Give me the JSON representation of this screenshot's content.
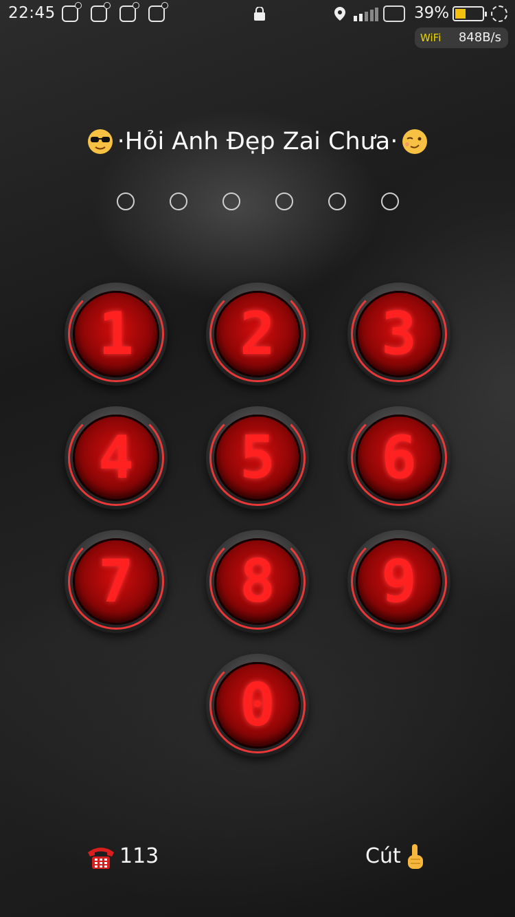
{
  "status_bar": {
    "time": "22:45",
    "notification_icons": [
      "mail-icon",
      "messenger-icon",
      "zalo-icon",
      "chat-icon"
    ],
    "battery_percent": "39%",
    "battery_level": 0.39,
    "network_speed_label": "WiFi",
    "network_speed_value": "848B/s"
  },
  "lock_screen": {
    "title": "·Hỏi Anh Đẹp Zai Chưa·",
    "title_left_emoji": "sunglasses-emoji",
    "title_right_emoji": "wink-emoji",
    "pin_length": 6,
    "keys": [
      "1",
      "2",
      "3",
      "4",
      "5",
      "6",
      "7",
      "8",
      "9",
      "0"
    ],
    "key_color": "#ff2020"
  },
  "bottom": {
    "emergency_label": "113",
    "cancel_label": "Cút"
  }
}
